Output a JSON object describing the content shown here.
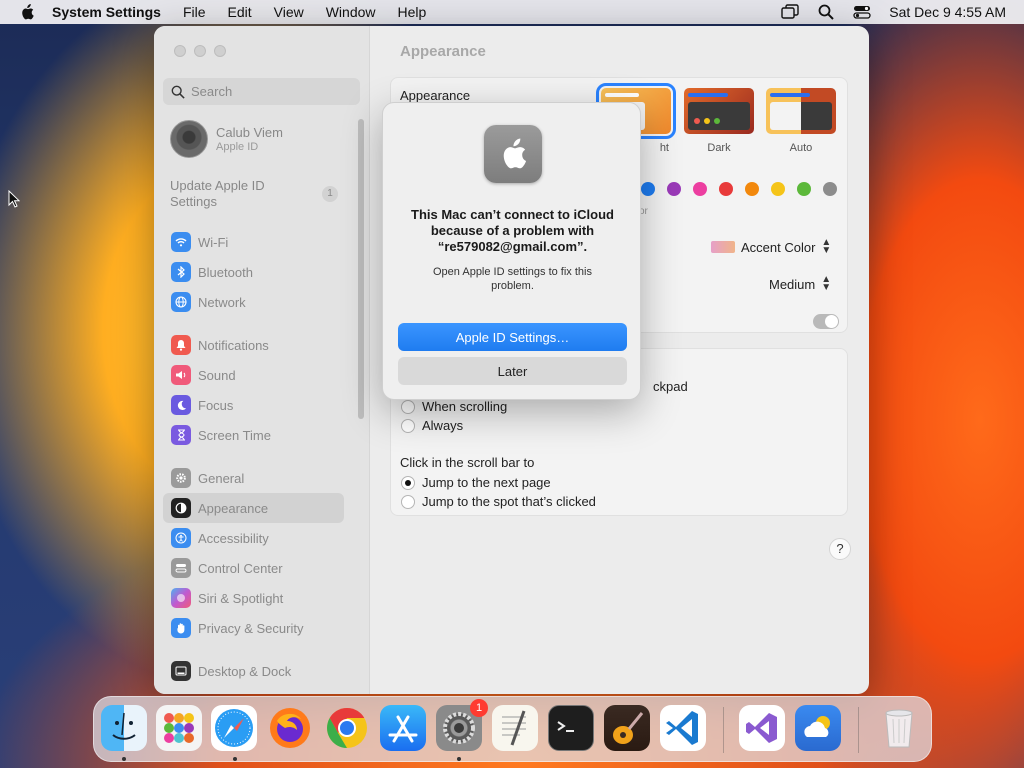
{
  "menubar": {
    "app_name": "System Settings",
    "items": [
      "File",
      "Edit",
      "View",
      "Window",
      "Help"
    ],
    "clock": "Sat Dec 9  4:55 AM"
  },
  "sidebar": {
    "search_placeholder": "Search",
    "profile": {
      "name": "Calub Viem",
      "subtitle": "Apple ID"
    },
    "update_label": "Update Apple ID Settings",
    "update_badge": "1",
    "items": [
      {
        "label": "Wi-Fi",
        "icon": "wifi-icon",
        "color": "#3b8df0"
      },
      {
        "label": "Bluetooth",
        "icon": "bluetooth-icon",
        "color": "#3b8df0"
      },
      {
        "label": "Network",
        "icon": "globe-icon",
        "color": "#3b8df0"
      },
      {
        "label": "Notifications",
        "icon": "bell-icon",
        "color": "#f05a4f"
      },
      {
        "label": "Sound",
        "icon": "speaker-icon",
        "color": "#f05a7a"
      },
      {
        "label": "Focus",
        "icon": "moon-icon",
        "color": "#6a5ae0"
      },
      {
        "label": "Screen Time",
        "icon": "hourglass-icon",
        "color": "#7a5ae0"
      },
      {
        "label": "General",
        "icon": "gear-icon",
        "color": "#9a9a9a"
      },
      {
        "label": "Appearance",
        "icon": "appearance-icon",
        "color": "#222222"
      },
      {
        "label": "Accessibility",
        "icon": "accessibility-icon",
        "color": "#3b8df0"
      },
      {
        "label": "Control Center",
        "icon": "control-center-icon",
        "color": "#9a9a9a"
      },
      {
        "label": "Siri & Spotlight",
        "icon": "siri-icon",
        "color": "#c05ad0"
      },
      {
        "label": "Privacy & Security",
        "icon": "hand-icon",
        "color": "#3b8df0"
      },
      {
        "label": "Desktop & Dock",
        "icon": "dock-icon",
        "color": "#333333"
      }
    ],
    "active": "Appearance"
  },
  "main": {
    "title": "Appearance",
    "appearance_label": "Appearance",
    "themes": [
      "ht",
      "Dark",
      "Auto"
    ],
    "accent_partial_label": "or",
    "accent_colors": [
      "#1e7cf0",
      "#9a3ab8",
      "#ec3ea0",
      "#e83a3a",
      "#f2880c",
      "#f5c418",
      "#5cb83a",
      "#8c8c8c"
    ],
    "highlight_value": "Accent Color",
    "highlight_swatch": "#e6a0c8",
    "sidebar_icon_size": "Medium",
    "scroll_partial_label": "ckpad",
    "scroll_options": [
      "When scrolling",
      "Always"
    ],
    "click_label": "Click in the scroll bar to",
    "click_options": [
      "Jump to the next page",
      "Jump to the spot that’s clicked"
    ],
    "help": "?"
  },
  "alert": {
    "title": "This Mac can’t connect to iCloud because of a problem with “re579082@gmail.com”.",
    "body": "Open Apple ID settings to fix this problem.",
    "primary": "Apple ID Settings…",
    "secondary": "Later"
  },
  "dock": {
    "apps": [
      "finder",
      "launchpad",
      "safari",
      "firefox",
      "chrome",
      "app-store",
      "system-settings",
      "textedit",
      "terminal",
      "garageband",
      "vscode",
      "visual-studio",
      "weather",
      "trash"
    ],
    "system_settings_badge": "1"
  }
}
